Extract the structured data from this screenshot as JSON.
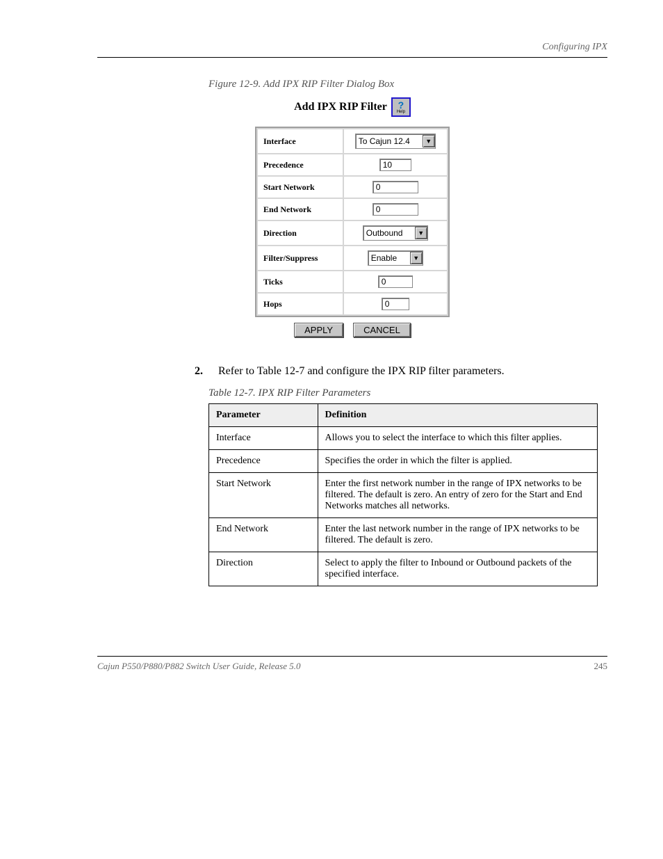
{
  "header": {
    "left": "",
    "right": "Configuring IPX"
  },
  "figure_title": "Figure 12-9. Add IPX RIP Filter Dialog Box",
  "shot": {
    "title": "Add IPX RIP Filter",
    "help_label": "Help",
    "rows": {
      "interface": {
        "label": "Interface",
        "value": "To Cajun 12.4"
      },
      "precedence": {
        "label": "Precedence",
        "value": "10"
      },
      "start_network": {
        "label": "Start Network",
        "value": "0"
      },
      "end_network": {
        "label": "End Network",
        "value": "0"
      },
      "direction": {
        "label": "Direction",
        "value": "Outbound"
      },
      "filter_suppress": {
        "label": "Filter/Suppress",
        "value": "Enable"
      },
      "ticks": {
        "label": "Ticks",
        "value": "0"
      },
      "hops": {
        "label": "Hops",
        "value": "0"
      }
    },
    "apply": "APPLY",
    "cancel": "CANCEL"
  },
  "step": {
    "num": "2.",
    "text": "Refer to Table 12-7 and configure the IPX RIP filter parameters."
  },
  "table_caption": "Table 12-7. IPX RIP Filter Parameters",
  "params_table": {
    "headers": [
      "Parameter",
      "Definition"
    ],
    "rows": [
      {
        "param": "Interface",
        "def": "Allows you to select the interface to which this filter applies."
      },
      {
        "param": "Precedence",
        "def": "Specifies the order in which the filter is applied."
      },
      {
        "param": "Start Network",
        "def": "Enter the first network number in the range of IPX networks to be filtered. The default is zero. An entry of zero for the Start and End Networks matches all networks."
      },
      {
        "param": "End Network",
        "def": "Enter the last network number in the range of IPX networks to be filtered. The default is zero."
      },
      {
        "param": "Direction",
        "def": "Select to apply the filter to Inbound or Outbound packets of the specified interface."
      }
    ]
  },
  "footer": {
    "left": "Cajun P550/P880/P882 Switch User Guide, Release 5.0",
    "right": "245"
  }
}
